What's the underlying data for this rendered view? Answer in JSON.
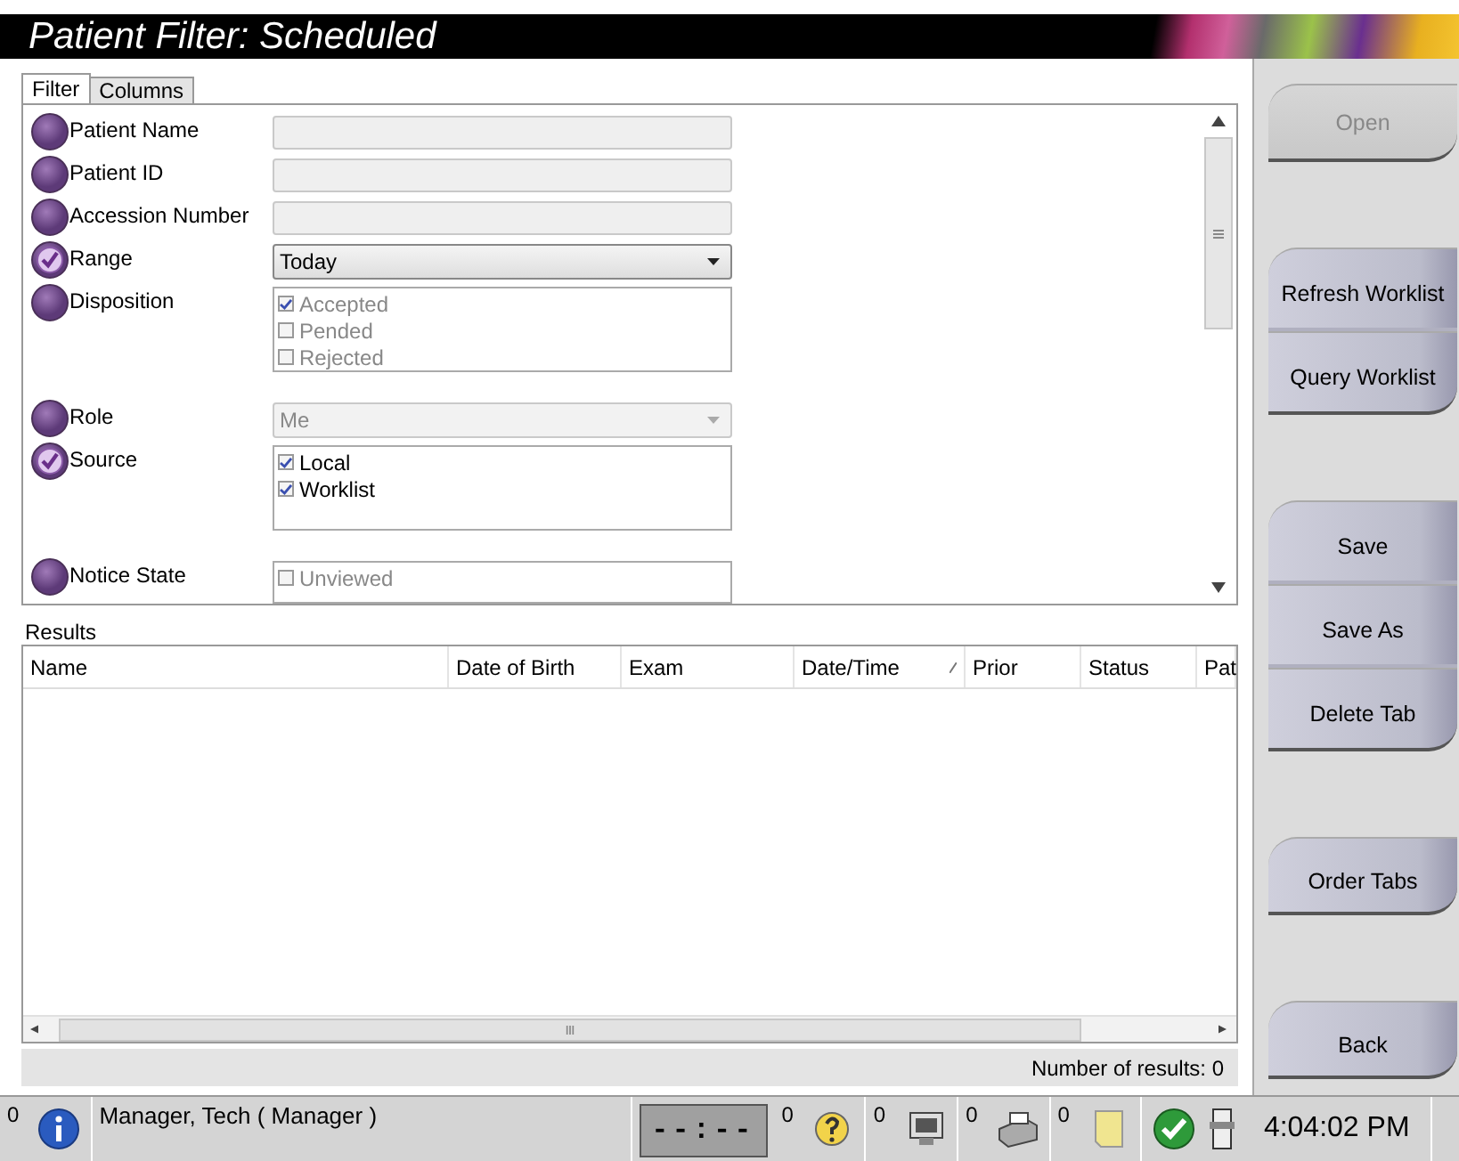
{
  "window": {
    "title": "Patient Filter: Scheduled"
  },
  "tabs": [
    {
      "label": "Filter",
      "selected": true
    },
    {
      "label": "Columns",
      "selected": false
    }
  ],
  "filters": [
    {
      "kind": "text",
      "label": "Patient Name",
      "checked": false
    },
    {
      "kind": "text",
      "label": "Patient ID",
      "checked": false
    },
    {
      "kind": "text",
      "label": "Accession Number",
      "checked": false
    },
    {
      "kind": "dropdown",
      "label": "Range",
      "checked": true,
      "value": "Today",
      "disabled": false
    },
    {
      "kind": "checklist",
      "label": "Disposition",
      "checked": false,
      "disabled": true,
      "options": [
        {
          "label": "Accepted",
          "checked": true
        },
        {
          "label": "Pended",
          "checked": false
        },
        {
          "label": "Rejected",
          "checked": false
        }
      ]
    },
    {
      "kind": "dropdown",
      "label": "Role",
      "checked": false,
      "value": "Me",
      "disabled": true
    },
    {
      "kind": "checklist",
      "label": "Source",
      "checked": true,
      "disabled": false,
      "options": [
        {
          "label": "Local",
          "checked": true
        },
        {
          "label": "Worklist",
          "checked": true
        }
      ]
    },
    {
      "kind": "checklist",
      "label": "Notice State",
      "checked": false,
      "disabled": true,
      "options": [
        {
          "label": "Unviewed",
          "checked": false
        }
      ]
    }
  ],
  "results": {
    "title": "Results",
    "columns": [
      {
        "label": "Name",
        "sorted": false
      },
      {
        "label": "Date of Birth",
        "sorted": false
      },
      {
        "label": "Exam",
        "sorted": false
      },
      {
        "label": "Date/Time",
        "sorted": true
      },
      {
        "label": "Prior",
        "sorted": false
      },
      {
        "label": "Status",
        "sorted": false
      },
      {
        "label": "Pat",
        "sorted": false
      }
    ],
    "footer": "Number of results: 0"
  },
  "button_groups": [
    [
      {
        "label": "Open",
        "disabled": true
      }
    ],
    [
      {
        "label": "Refresh Worklist",
        "disabled": false
      },
      {
        "label": "Query Worklist",
        "disabled": false
      }
    ],
    [
      {
        "label": "Save",
        "disabled": false
      },
      {
        "label": "Save As",
        "disabled": false
      },
      {
        "label": "Delete Tab",
        "disabled": false
      }
    ],
    [
      {
        "label": "Order Tabs",
        "disabled": false
      }
    ],
    [
      {
        "label": "Back",
        "disabled": false
      }
    ]
  ],
  "status_bar": {
    "alert_count": "0",
    "user": "Manager, Tech ( Manager )",
    "timer": "--:--",
    "indicators": [
      {
        "kind": "help",
        "count": "0"
      },
      {
        "kind": "monitor",
        "count": "0"
      },
      {
        "kind": "printer",
        "count": "0"
      },
      {
        "kind": "note",
        "count": "0"
      }
    ],
    "time": "4:04:02 PM"
  }
}
